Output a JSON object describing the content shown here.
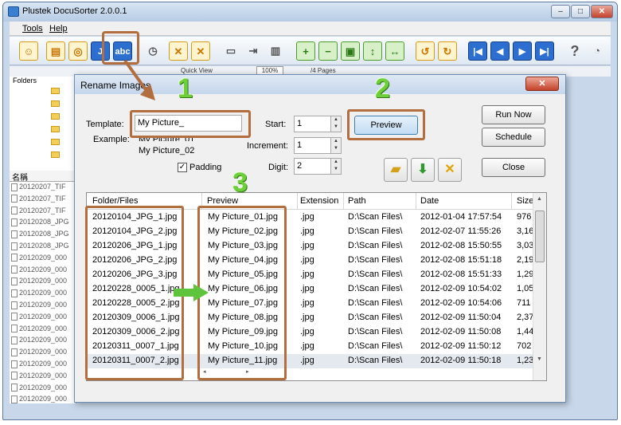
{
  "app": {
    "title": "Plustek DocuSorter 2.0.0.1"
  },
  "window_controls": {
    "minimize": "‒",
    "maximize": "□",
    "close": "✕"
  },
  "menu": [
    "Tools",
    "Help"
  ],
  "toolbar": {
    "icons": [
      "person-icon",
      "folder-icon",
      "inspect-icon",
      "jpg-pdf-icon",
      "rename-abc-icon",
      "clock-icon",
      "pdf-delete-icon",
      "tiff-delete-icon",
      "scanner-icon",
      "export-icon",
      "barcode-icon",
      "zoom-in-icon",
      "zoom-out-icon",
      "fit-page-icon",
      "fit-height-icon",
      "fit-width-icon",
      "rotate-left-icon",
      "rotate-right-icon",
      "first-page-icon",
      "prev-page-icon",
      "next-page-icon",
      "last-page-icon",
      "help-icon",
      "about-icon"
    ]
  },
  "infobar": {
    "quick_view": "Quick View",
    "zoom": "100%",
    "pages": "/4 Pages"
  },
  "sidebar": {
    "folders_label": "Folders",
    "name_header": "名稱",
    "files": [
      "20120207_TIF",
      "20120207_TIF",
      "20120207_TIF",
      "20120208_JPG",
      "20120208_JPG",
      "20120208_JPG",
      "20120209_000",
      "20120209_000",
      "20120209_000",
      "20120209_000",
      "20120209_000",
      "20120209_000",
      "20120209_000",
      "20120209_000",
      "20120209_000",
      "20120209_000",
      "20120209_000",
      "20120209_000",
      "20120209_000"
    ]
  },
  "dialog": {
    "title": "Rename Images",
    "close": "✕",
    "template_label": "Template:",
    "template_value": "My Picture_",
    "example_label": "Example:",
    "example_1": "My Picture_01",
    "example_2": "My Picture_02",
    "start_label": "Start:",
    "start_value": "1",
    "increment_label": "Increment:",
    "increment_value": "1",
    "digit_label": "Digit:",
    "digit_value": "2",
    "padding_label": "Padding",
    "padding_checked": true,
    "preview_button": "Preview",
    "run_now_button": "Run Now",
    "schedule_button": "Schedule",
    "close_button": "Close",
    "icon_buttons": [
      "open-folder-icon",
      "download-arrow-icon",
      "clear-x-icon"
    ]
  },
  "annotations": [
    "1",
    "2",
    "3"
  ],
  "table": {
    "columns": [
      "Folder/Files",
      "Preview",
      "Extension",
      "Path",
      "Date",
      "Size"
    ],
    "rows": [
      [
        "20120104_JPG_1.jpg",
        "My Picture_01.jpg",
        ".jpg",
        "D:\\Scan Files\\",
        "2012-01-04 17:57:54",
        "976"
      ],
      [
        "20120104_JPG_2.jpg",
        "My Picture_02.jpg",
        ".jpg",
        "D:\\Scan Files\\",
        "2012-02-07 11:55:26",
        "3,16"
      ],
      [
        "20120206_JPG_1.jpg",
        "My Picture_03.jpg",
        ".jpg",
        "D:\\Scan Files\\",
        "2012-02-08 15:50:55",
        "3,03"
      ],
      [
        "20120206_JPG_2.jpg",
        "My Picture_04.jpg",
        ".jpg",
        "D:\\Scan Files\\",
        "2012-02-08 15:51:18",
        "2,19"
      ],
      [
        "20120206_JPG_3.jpg",
        "My Picture_05.jpg",
        ".jpg",
        "D:\\Scan Files\\",
        "2012-02-08 15:51:33",
        "1,29"
      ],
      [
        "20120228_0005_1.jpg",
        "My Picture_06.jpg",
        ".jpg",
        "D:\\Scan Files\\",
        "2012-02-09 10:54:02",
        "1,05"
      ],
      [
        "20120228_0005_2.jpg",
        "My Picture_07.jpg",
        ".jpg",
        "D:\\Scan Files\\",
        "2012-02-09 10:54:06",
        "711"
      ],
      [
        "20120309_0006_1.jpg",
        "My Picture_08.jpg",
        ".jpg",
        "D:\\Scan Files\\",
        "2012-02-09 11:50:04",
        "2,37"
      ],
      [
        "20120309_0006_2.jpg",
        "My Picture_09.jpg",
        ".jpg",
        "D:\\Scan Files\\",
        "2012-02-09 11:50:08",
        "1,44"
      ],
      [
        "20120311_0007_1.jpg",
        "My Picture_10.jpg",
        ".jpg",
        "D:\\Scan Files\\",
        "2012-02-09 11:50:12",
        "702"
      ],
      [
        "20120311_0007_2.jpg",
        "My Picture_11.jpg",
        ".jpg",
        "D:\\Scan Files\\",
        "2012-02-09 11:50:18",
        "1,23"
      ]
    ]
  },
  "colors": {
    "annotation_box": "#b26e3e",
    "annotation_number": "#6fcf3a",
    "selected_row": "#e4e9ef"
  }
}
